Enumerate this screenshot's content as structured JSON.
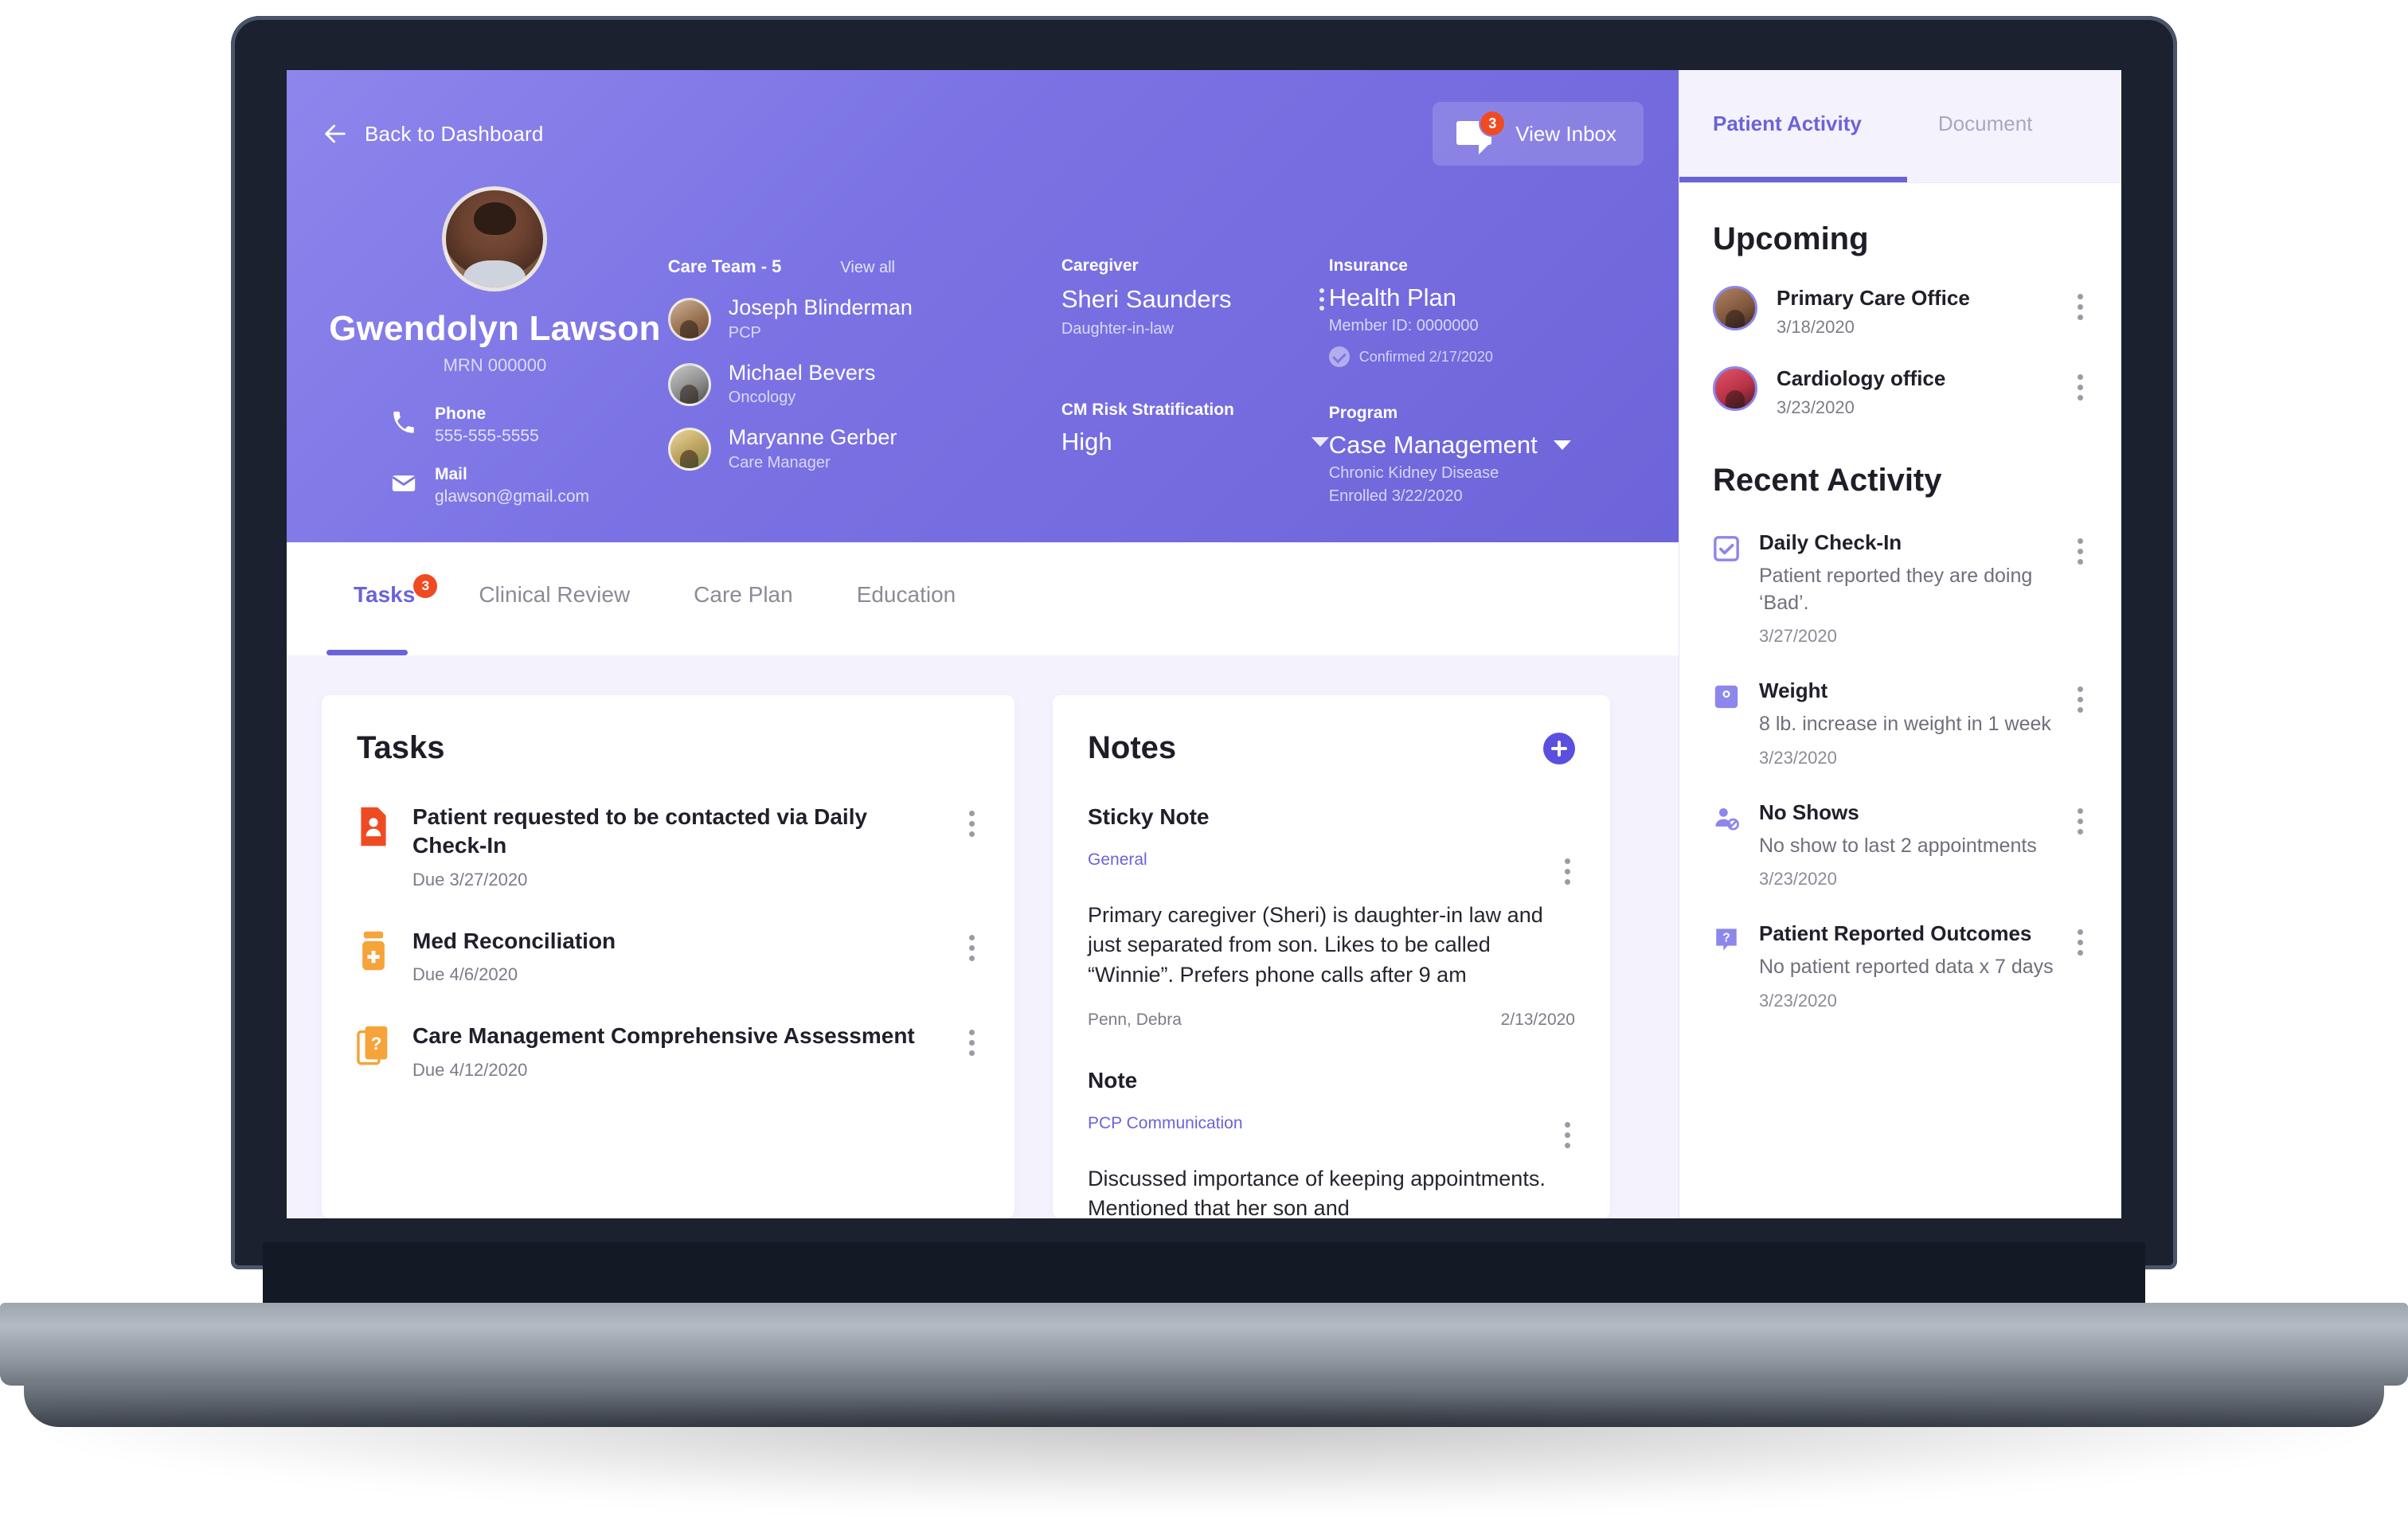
{
  "header": {
    "back_label": "Back to Dashboard",
    "back_icon": "arrow-left-icon",
    "inbox_label": "View Inbox",
    "inbox_icon": "chat-bubble-icon",
    "inbox_badge": "3",
    "accent_purple": "#6C63D8",
    "badge_red": "#EF4B23"
  },
  "patient": {
    "name": "Gwendolyn Lawson",
    "mrn": "MRN 000000",
    "avatar_icon": "patient-photo",
    "contacts": [
      {
        "icon": "phone-icon",
        "label": "Phone",
        "value": "555-555-5555"
      },
      {
        "icon": "mail-icon",
        "label": "Mail",
        "value": "glawson@gmail.com"
      }
    ]
  },
  "care_team": {
    "title": "Care Team - 5",
    "view_all": "View all",
    "members": [
      {
        "name": "Joseph Blinderman",
        "role": "PCP"
      },
      {
        "name": "Michael Bevers",
        "role": "Oncology"
      },
      {
        "name": "Maryanne Gerber",
        "role": "Care Manager"
      }
    ]
  },
  "caregiver": {
    "label": "Caregiver",
    "name": "Sheri Saunders",
    "relation": "Daughter-in-law",
    "menu_icon": "kebab-menu-icon"
  },
  "risk": {
    "label": "CM Risk Stratification",
    "value": "High",
    "caret_icon": "chevron-down-icon"
  },
  "insurance": {
    "label": "Insurance",
    "plan": "Health Plan",
    "member_id": "Member ID: 0000000",
    "confirmed": "Confirmed 2/17/2020",
    "confirmed_icon": "check-circle-icon"
  },
  "program": {
    "label": "Program",
    "value": "Case Management",
    "caret_icon": "chevron-down-icon",
    "condition": "Chronic Kidney Disease",
    "enrolled": "Enrolled 3/22/2020"
  },
  "tabs": [
    {
      "label": "Tasks",
      "badge": "3",
      "active": true
    },
    {
      "label": "Clinical Review",
      "badge": "",
      "active": false
    },
    {
      "label": "Care Plan",
      "badge": "",
      "active": false
    },
    {
      "label": "Education",
      "badge": "",
      "active": false
    }
  ],
  "tasks_card": {
    "title": "Tasks",
    "items": [
      {
        "icon": "patient-document-icon",
        "icon_color": "#EF4B23",
        "title": "Patient requested to be contacted via Daily Check-In",
        "due": "Due 3/27/2020",
        "menu_icon": "kebab-menu-icon"
      },
      {
        "icon": "medication-bottle-icon",
        "icon_color": "#F6A33A",
        "title": "Med Reconciliation",
        "due": "Due 4/6/2020",
        "menu_icon": "kebab-menu-icon"
      },
      {
        "icon": "assessment-question-icon",
        "icon_color": "#F6A33A",
        "title": "Care Management Comprehensive Assessment",
        "due": "Due 4/12/2020",
        "menu_icon": "kebab-menu-icon"
      }
    ]
  },
  "notes_card": {
    "title": "Notes",
    "add_icon": "plus-circle-icon",
    "sections": [
      {
        "heading": "Sticky Note",
        "tag": "General",
        "body": "Primary caregiver (Sheri) is daughter-in law and just separated from son. Likes to be called “Winnie”. Prefers phone calls after 9 am",
        "author": "Penn, Debra",
        "date": "2/13/2020",
        "menu_icon": "kebab-menu-icon"
      },
      {
        "heading": "Note",
        "tag": "PCP Communication",
        "body": "Discussed importance of keeping appointments. Mentioned that her son and",
        "author": "",
        "date": "",
        "menu_icon": "kebab-menu-icon"
      }
    ]
  },
  "side_panel": {
    "tabs": [
      {
        "label": "Patient Activity",
        "active": true
      },
      {
        "label": "Document",
        "active": false
      }
    ],
    "upcoming_title": "Upcoming",
    "upcoming": [
      {
        "title": "Primary Care Office",
        "date": "3/18/2020",
        "avatar_icon": "provider-photo",
        "menu_icon": "kebab-menu-icon"
      },
      {
        "title": "Cardiology office",
        "date": "3/23/2020",
        "avatar_icon": "provider-photo",
        "menu_icon": "kebab-menu-icon"
      }
    ],
    "recent_title": "Recent Activity",
    "recent": [
      {
        "icon": "checkbox-icon",
        "title": "Daily Check-In",
        "desc": "Patient reported they are doing ‘Bad’.",
        "date": "3/27/2020",
        "menu_icon": "kebab-menu-icon"
      },
      {
        "icon": "weight-scale-icon",
        "title": "Weight",
        "desc": "8 lb. increase in weight in 1 week",
        "date": "3/23/2020",
        "menu_icon": "kebab-menu-icon"
      },
      {
        "icon": "no-show-person-icon",
        "title": "No Shows",
        "desc": "No show to last 2 appointments",
        "date": "3/23/2020",
        "menu_icon": "kebab-menu-icon"
      },
      {
        "icon": "question-bubble-icon",
        "title": "Patient Reported Outcomes",
        "desc": "No patient reported data x 7 days",
        "date": "3/23/2020",
        "menu_icon": "kebab-menu-icon"
      }
    ]
  }
}
